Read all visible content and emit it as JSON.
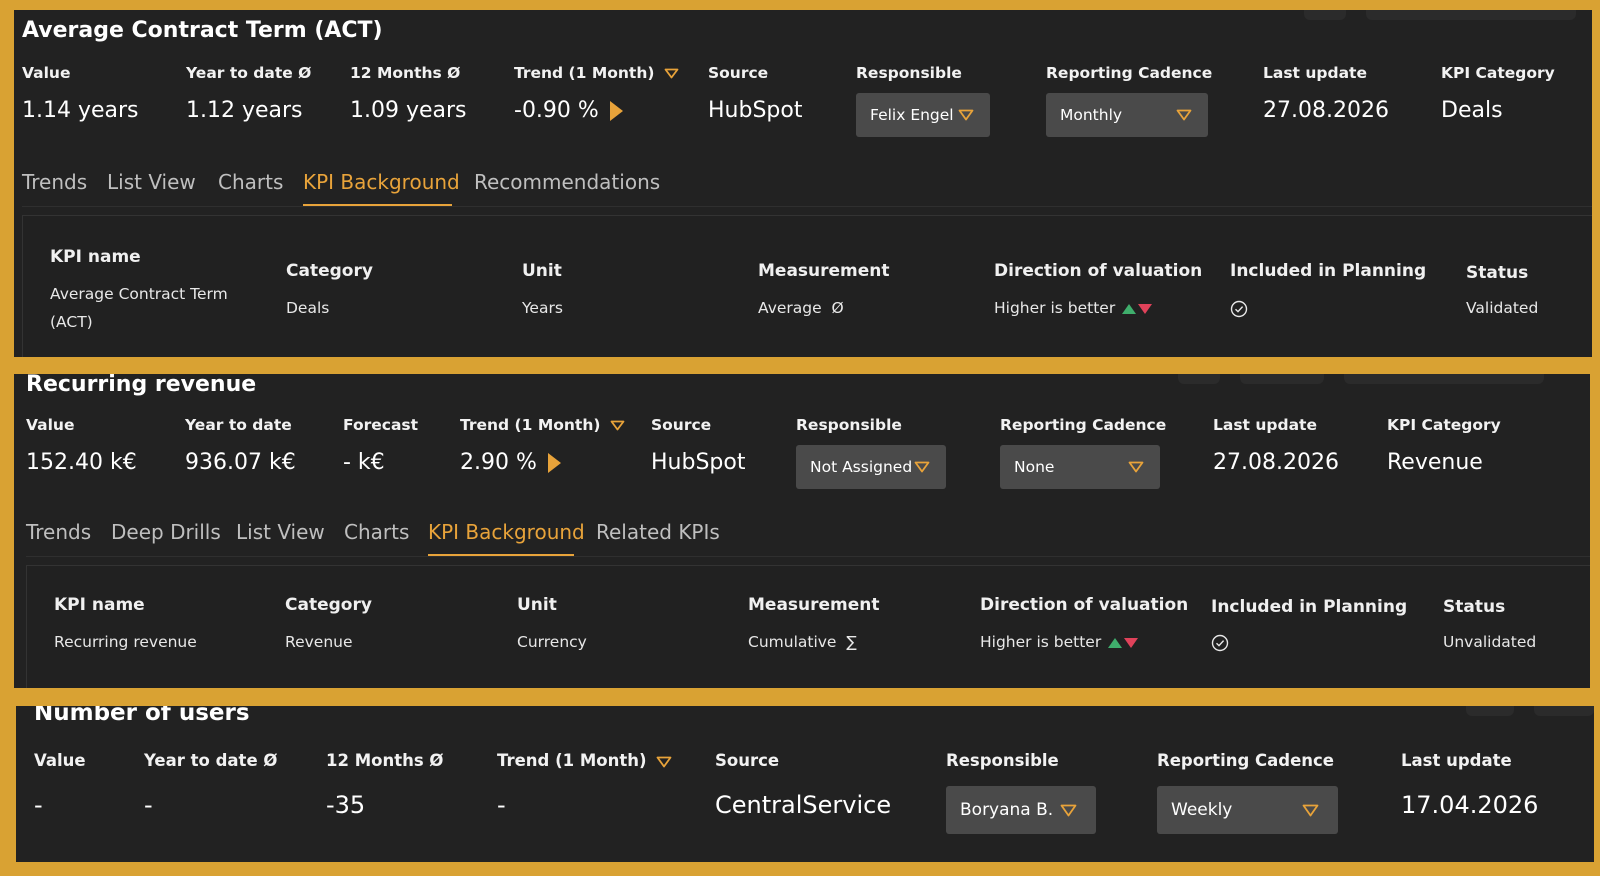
{
  "colors": {
    "frame": "#d9a233",
    "panel": "#222222",
    "accent": "#e8a33a",
    "dropdown_bg": "#4a4a4a",
    "up_arrow": "#3fae6c",
    "down_arrow": "#e0425a"
  },
  "panels": [
    {
      "title": "Average Contract Term (ACT)",
      "metrics": {
        "value": {
          "label": "Value",
          "value": "1.14 years"
        },
        "ytd": {
          "label": "Year to date Ø",
          "value": "1.12 years"
        },
        "third": {
          "label": "12 Months Ø",
          "value": "1.09 years"
        },
        "trend": {
          "label": "Trend (1 Month)",
          "value": "-0.90 %"
        },
        "source": {
          "label": "Source",
          "value": "HubSpot"
        },
        "responsible": {
          "label": "Responsible",
          "value": "Felix Engel"
        },
        "cadence": {
          "label": "Reporting Cadence",
          "value": "Monthly"
        },
        "last_update": {
          "label": "Last update",
          "value": "27.08.2026"
        },
        "category": {
          "label": "KPI Category",
          "value": "Deals"
        }
      },
      "tabs": [
        "Trends",
        "List View",
        "Charts",
        "KPI Background",
        "Recommendations"
      ],
      "active_tab": "KPI Background",
      "background": {
        "headers": [
          "KPI name",
          "Category",
          "Unit",
          "Measurement",
          "Direction of valuation",
          "Included in Planning",
          "Status"
        ],
        "kpi_name": "Average Contract Term (ACT)",
        "category": "Deals",
        "unit": "Years",
        "measurement": "Average",
        "measurement_symbol": "Ø",
        "direction": "Higher is better",
        "included_icon": "check-circle-icon",
        "status": "Validated"
      }
    },
    {
      "title": "Recurring revenue",
      "metrics": {
        "value": {
          "label": "Value",
          "value": "152.40 k€"
        },
        "ytd": {
          "label": "Year to date",
          "value": "936.07 k€"
        },
        "third": {
          "label": "Forecast",
          "value": "- k€"
        },
        "trend": {
          "label": "Trend (1 Month)",
          "value": "2.90 %"
        },
        "source": {
          "label": "Source",
          "value": "HubSpot"
        },
        "responsible": {
          "label": "Responsible",
          "value": "Not Assigned"
        },
        "cadence": {
          "label": "Reporting Cadence",
          "value": "None"
        },
        "last_update": {
          "label": "Last update",
          "value": "27.08.2026"
        },
        "category": {
          "label": "KPI Category",
          "value": "Revenue"
        }
      },
      "tabs": [
        "Trends",
        "Deep Drills",
        "List View",
        "Charts",
        "KPI Background",
        "Related KPIs"
      ],
      "active_tab": "KPI Background",
      "background": {
        "headers": [
          "KPI name",
          "Category",
          "Unit",
          "Measurement",
          "Direction of valuation",
          "Included in Planning",
          "Status"
        ],
        "kpi_name": "Recurring revenue",
        "category": "Revenue",
        "unit": "Currency",
        "measurement": "Cumulative",
        "measurement_symbol": "∑",
        "direction": "Higher is better",
        "included_icon": "check-circle-icon",
        "status": "Unvalidated"
      }
    },
    {
      "title": "Number of users",
      "metrics": {
        "value": {
          "label": "Value",
          "value": "-"
        },
        "ytd": {
          "label": "Year to date Ø",
          "value": "-"
        },
        "third": {
          "label": "12 Months Ø",
          "value": "-35"
        },
        "trend": {
          "label": "Trend (1 Month)",
          "value": "-"
        },
        "source": {
          "label": "Source",
          "value": "CentralService"
        },
        "responsible": {
          "label": "Responsible",
          "value": "Boryana B."
        },
        "cadence": {
          "label": "Reporting Cadence",
          "value": "Weekly"
        },
        "last_update": {
          "label": "Last update",
          "value": "17.04.2026"
        }
      }
    }
  ]
}
